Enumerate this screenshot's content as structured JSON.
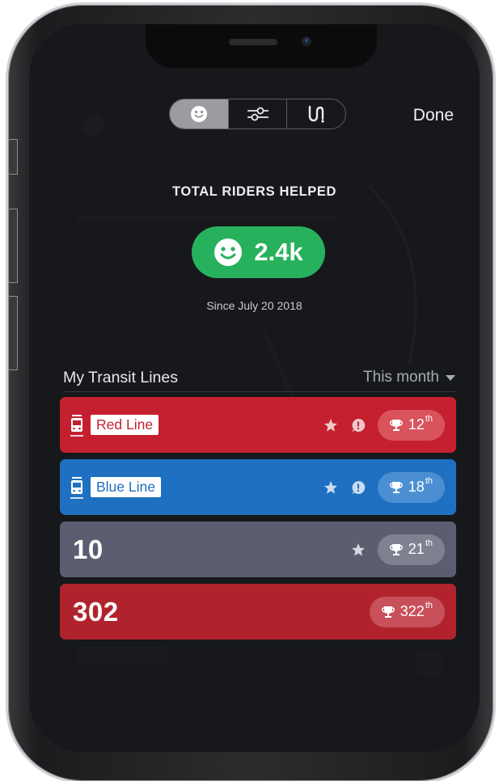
{
  "header": {
    "tabs": [
      {
        "icon": "smiley-icon",
        "active": true
      },
      {
        "icon": "sliders-icon",
        "active": false
      },
      {
        "icon": "route-icon",
        "active": false
      }
    ],
    "done_label": "Done"
  },
  "stats": {
    "title": "TOTAL RIDERS HELPED",
    "riders_value": "2.4k",
    "since": "Since July 20 2018"
  },
  "section": {
    "title": "My Transit Lines",
    "period": "This month"
  },
  "lines": [
    {
      "type": "label",
      "name": "Red Line",
      "color": "#c5202f",
      "star": true,
      "alert": true,
      "rank": "12",
      "suffix": "th"
    },
    {
      "type": "label",
      "name": "Blue Line",
      "color": "#1f70c0",
      "star": true,
      "alert": true,
      "rank": "18",
      "suffix": "th"
    },
    {
      "type": "number",
      "name": "10",
      "color": "#5a5e70",
      "star": true,
      "alert": false,
      "rank": "21",
      "suffix": "th"
    },
    {
      "type": "number",
      "name": "302",
      "color": "#b1232c",
      "star": false,
      "alert": false,
      "rank": "322",
      "suffix": "th"
    }
  ],
  "colors": {
    "accent_green": "#27b15c",
    "background": "#16181b"
  }
}
